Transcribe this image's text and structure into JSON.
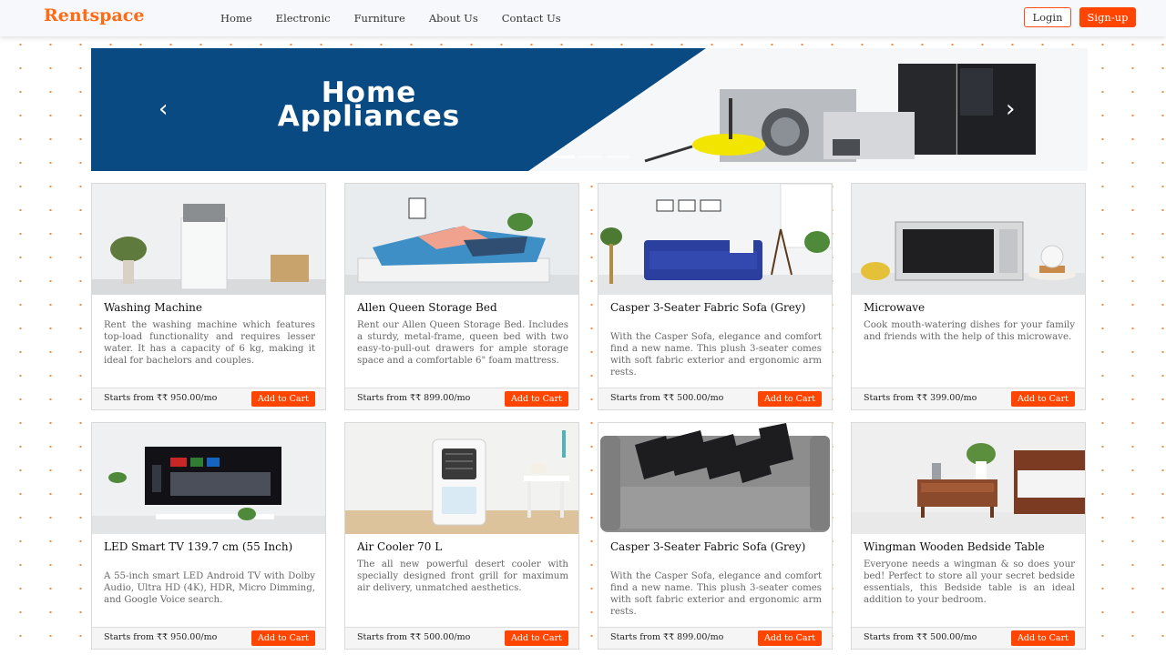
{
  "brand": "Rentspace",
  "nav": {
    "links": [
      "Home",
      "Electronic",
      "Furniture",
      "About Us",
      "Contact Us"
    ]
  },
  "auth": {
    "login": "Login",
    "signup": "Sign-up"
  },
  "carousel": {
    "line1": "Home",
    "line2": "Appliances",
    "prev_icon": "‹",
    "next_icon": "›",
    "slide_count": 3,
    "active_slide": 1
  },
  "colors": {
    "brand": "#ff6a13",
    "accent": "#ff4500",
    "banner": "#0a4a82"
  },
  "cart_label": "Add to Cart",
  "products": [
    {
      "title": "Washing Machine",
      "desc": "Rent the washing machine which features top-load functionality and requires lesser water. It has a capacity of 6 kg, making it ideal for bachelors and couples.",
      "price": "Starts from ₹₹ 950.00/mo"
    },
    {
      "title": "Allen Queen Storage Bed",
      "desc": "Rent our Allen Queen Storage Bed. Includes a sturdy, metal-frame, queen bed with two easy-to-pull-out drawers for ample storage space and a comfortable 6\" foam mattress.",
      "price": "Starts from ₹₹ 899.00/mo"
    },
    {
      "title": "Casper 3-Seater Fabric Sofa (Grey)",
      "desc": "With the Casper Sofa, elegance and comfort find a new name. This plush 3-seater comes with soft fabric exterior and ergonomic arm rests.",
      "price": "Starts from ₹₹ 500.00/mo"
    },
    {
      "title": "Microwave",
      "desc": "Cook mouth-watering dishes for your family and friends with the help of this microwave.",
      "price": "Starts from ₹₹ 399.00/mo"
    },
    {
      "title": "LED Smart TV 139.7 cm (55 Inch)",
      "desc": "A 55-inch smart LED Android TV with Dolby Audio, Ultra HD (4K), HDR, Micro Dimming, and Google Voice search.",
      "price": "Starts from ₹₹ 950.00/mo"
    },
    {
      "title": "Air Cooler 70 L",
      "desc": "The all new powerful desert cooler with specially designed front grill for maximum air delivery, unmatched aesthetics.",
      "price": "Starts from ₹₹ 500.00/mo"
    },
    {
      "title": "Casper 3-Seater Fabric Sofa (Grey)",
      "desc": "With the Casper Sofa, elegance and comfort find a new name. This plush 3-seater comes with soft fabric exterior and ergonomic arm rests.",
      "price": "Starts from ₹₹ 899.00/mo"
    },
    {
      "title": "Wingman Wooden Bedside Table",
      "desc": "Everyone needs a wingman & so does your bed! Perfect to store all your secret bedside essentials, this Bedside table is an ideal addition to your bedroom.",
      "price": "Starts from ₹₹ 500.00/mo"
    }
  ]
}
